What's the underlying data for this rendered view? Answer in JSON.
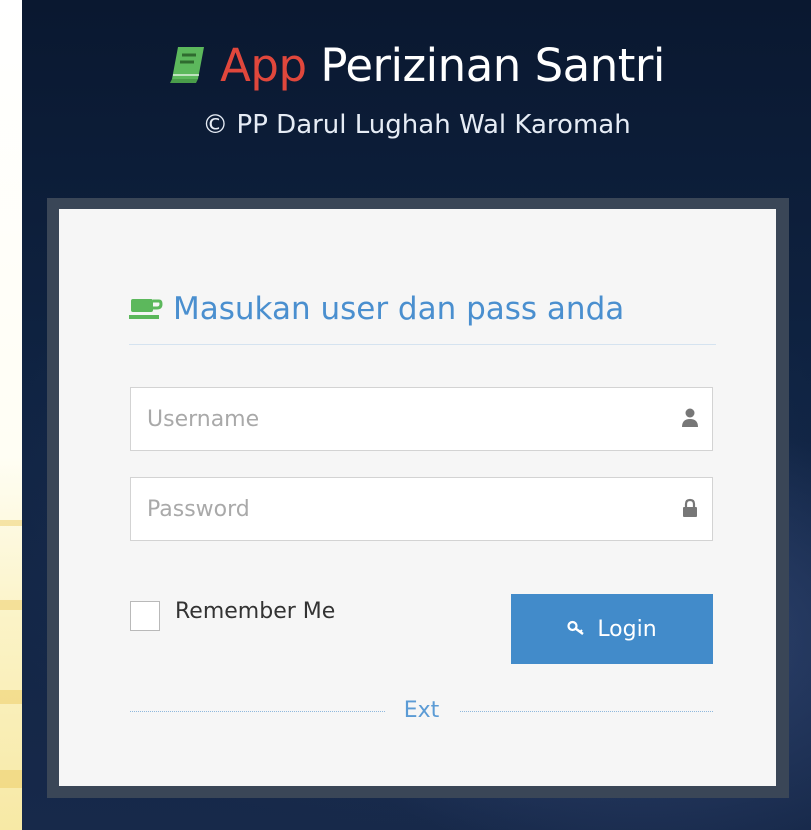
{
  "header": {
    "title_app": "App",
    "title_rest": "Perizinan Santri",
    "subtitle": "© PP Darul Lughah Wal Karomah"
  },
  "login_form": {
    "heading": "Masukan user dan pass anda",
    "username": {
      "value": "",
      "placeholder": "Username"
    },
    "password": {
      "value": "",
      "placeholder": "Password"
    },
    "remember_label": "Remember Me",
    "remember_checked": false,
    "login_label": "Login",
    "divider_text": "Ext"
  },
  "colors": {
    "app_word": "#e0473c",
    "icon_green": "#5cb85c",
    "accent_blue": "#428bca",
    "heading_blue": "#4a8fcf"
  },
  "icons": {
    "title": "book-icon",
    "heading": "coffee-cup-icon",
    "username": "user-icon",
    "password": "lock-icon",
    "login": "key-icon"
  }
}
